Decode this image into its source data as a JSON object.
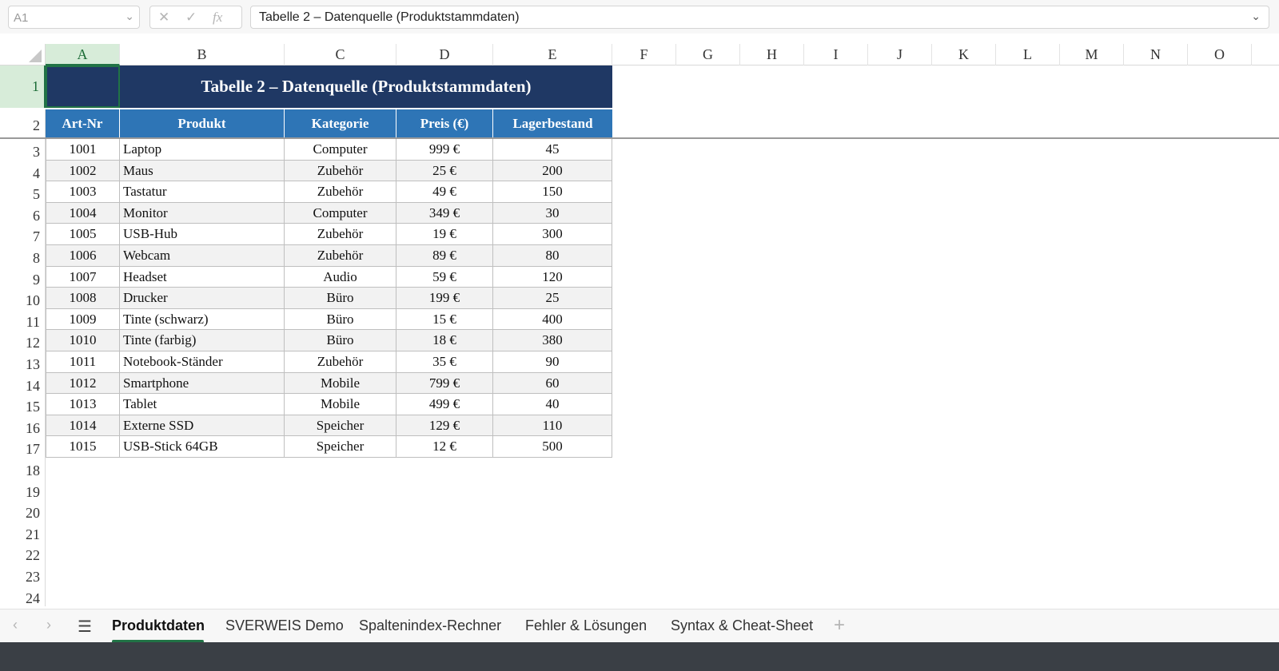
{
  "formula_bar": {
    "name_box": "A1",
    "cancel_icon": "✕",
    "confirm_icon": "✓",
    "fx_icon": "fx",
    "content": "Tabelle 2 – Datenquelle (Produktstammdaten)"
  },
  "columns": [
    "A",
    "B",
    "C",
    "D",
    "E",
    "F",
    "G",
    "H",
    "I",
    "J",
    "K",
    "L",
    "M",
    "N",
    "O"
  ],
  "rows": [
    "1",
    "2",
    "3",
    "4",
    "5",
    "6",
    "7",
    "8",
    "9",
    "10",
    "11",
    "12",
    "13",
    "14",
    "15",
    "16",
    "17",
    "18",
    "19",
    "20",
    "21",
    "22",
    "23",
    "24"
  ],
  "sheet": {
    "title": "Tabelle 2 – Datenquelle (Produktstammdaten)",
    "headers": [
      "Art-Nr",
      "Produkt",
      "Kategorie",
      "Preis (€)",
      "Lagerbestand"
    ],
    "data": [
      [
        "1001",
        "Laptop",
        "Computer",
        "999 €",
        "45"
      ],
      [
        "1002",
        "Maus",
        "Zubehör",
        "25 €",
        "200"
      ],
      [
        "1003",
        "Tastatur",
        "Zubehör",
        "49 €",
        "150"
      ],
      [
        "1004",
        "Monitor",
        "Computer",
        "349 €",
        "30"
      ],
      [
        "1005",
        "USB-Hub",
        "Zubehör",
        "19 €",
        "300"
      ],
      [
        "1006",
        "Webcam",
        "Zubehör",
        "89 €",
        "80"
      ],
      [
        "1007",
        "Headset",
        "Audio",
        "59 €",
        "120"
      ],
      [
        "1008",
        "Drucker",
        "Büro",
        "199 €",
        "25"
      ],
      [
        "1009",
        "Tinte (schwarz)",
        "Büro",
        "15 €",
        "400"
      ],
      [
        "1010",
        "Tinte (farbig)",
        "Büro",
        "18 €",
        "380"
      ],
      [
        "1011",
        "Notebook-Ständer",
        "Zubehör",
        "35 €",
        "90"
      ],
      [
        "1012",
        "Smartphone",
        "Mobile",
        "799 €",
        "60"
      ],
      [
        "1013",
        "Tablet",
        "Mobile",
        "499 €",
        "40"
      ],
      [
        "1014",
        "Externe SSD",
        "Speicher",
        "129 €",
        "110"
      ],
      [
        "1015",
        "USB-Stick 64GB",
        "Speicher",
        "12 €",
        "500"
      ]
    ]
  },
  "tabs": {
    "prev_icon": "‹",
    "next_icon": "›",
    "menu_icon": "☰",
    "add_icon": "+",
    "items": [
      "Produktdaten",
      "SVERWEIS Demo",
      "Spaltenindex-Rechner",
      "Fehler & Lösungen",
      "Syntax & Cheat-Sheet"
    ]
  },
  "colors": {
    "title_fill": "#1f3864",
    "header_fill": "#2e75b6",
    "selection": "#217346",
    "alt_row": "#f2f2f2"
  }
}
